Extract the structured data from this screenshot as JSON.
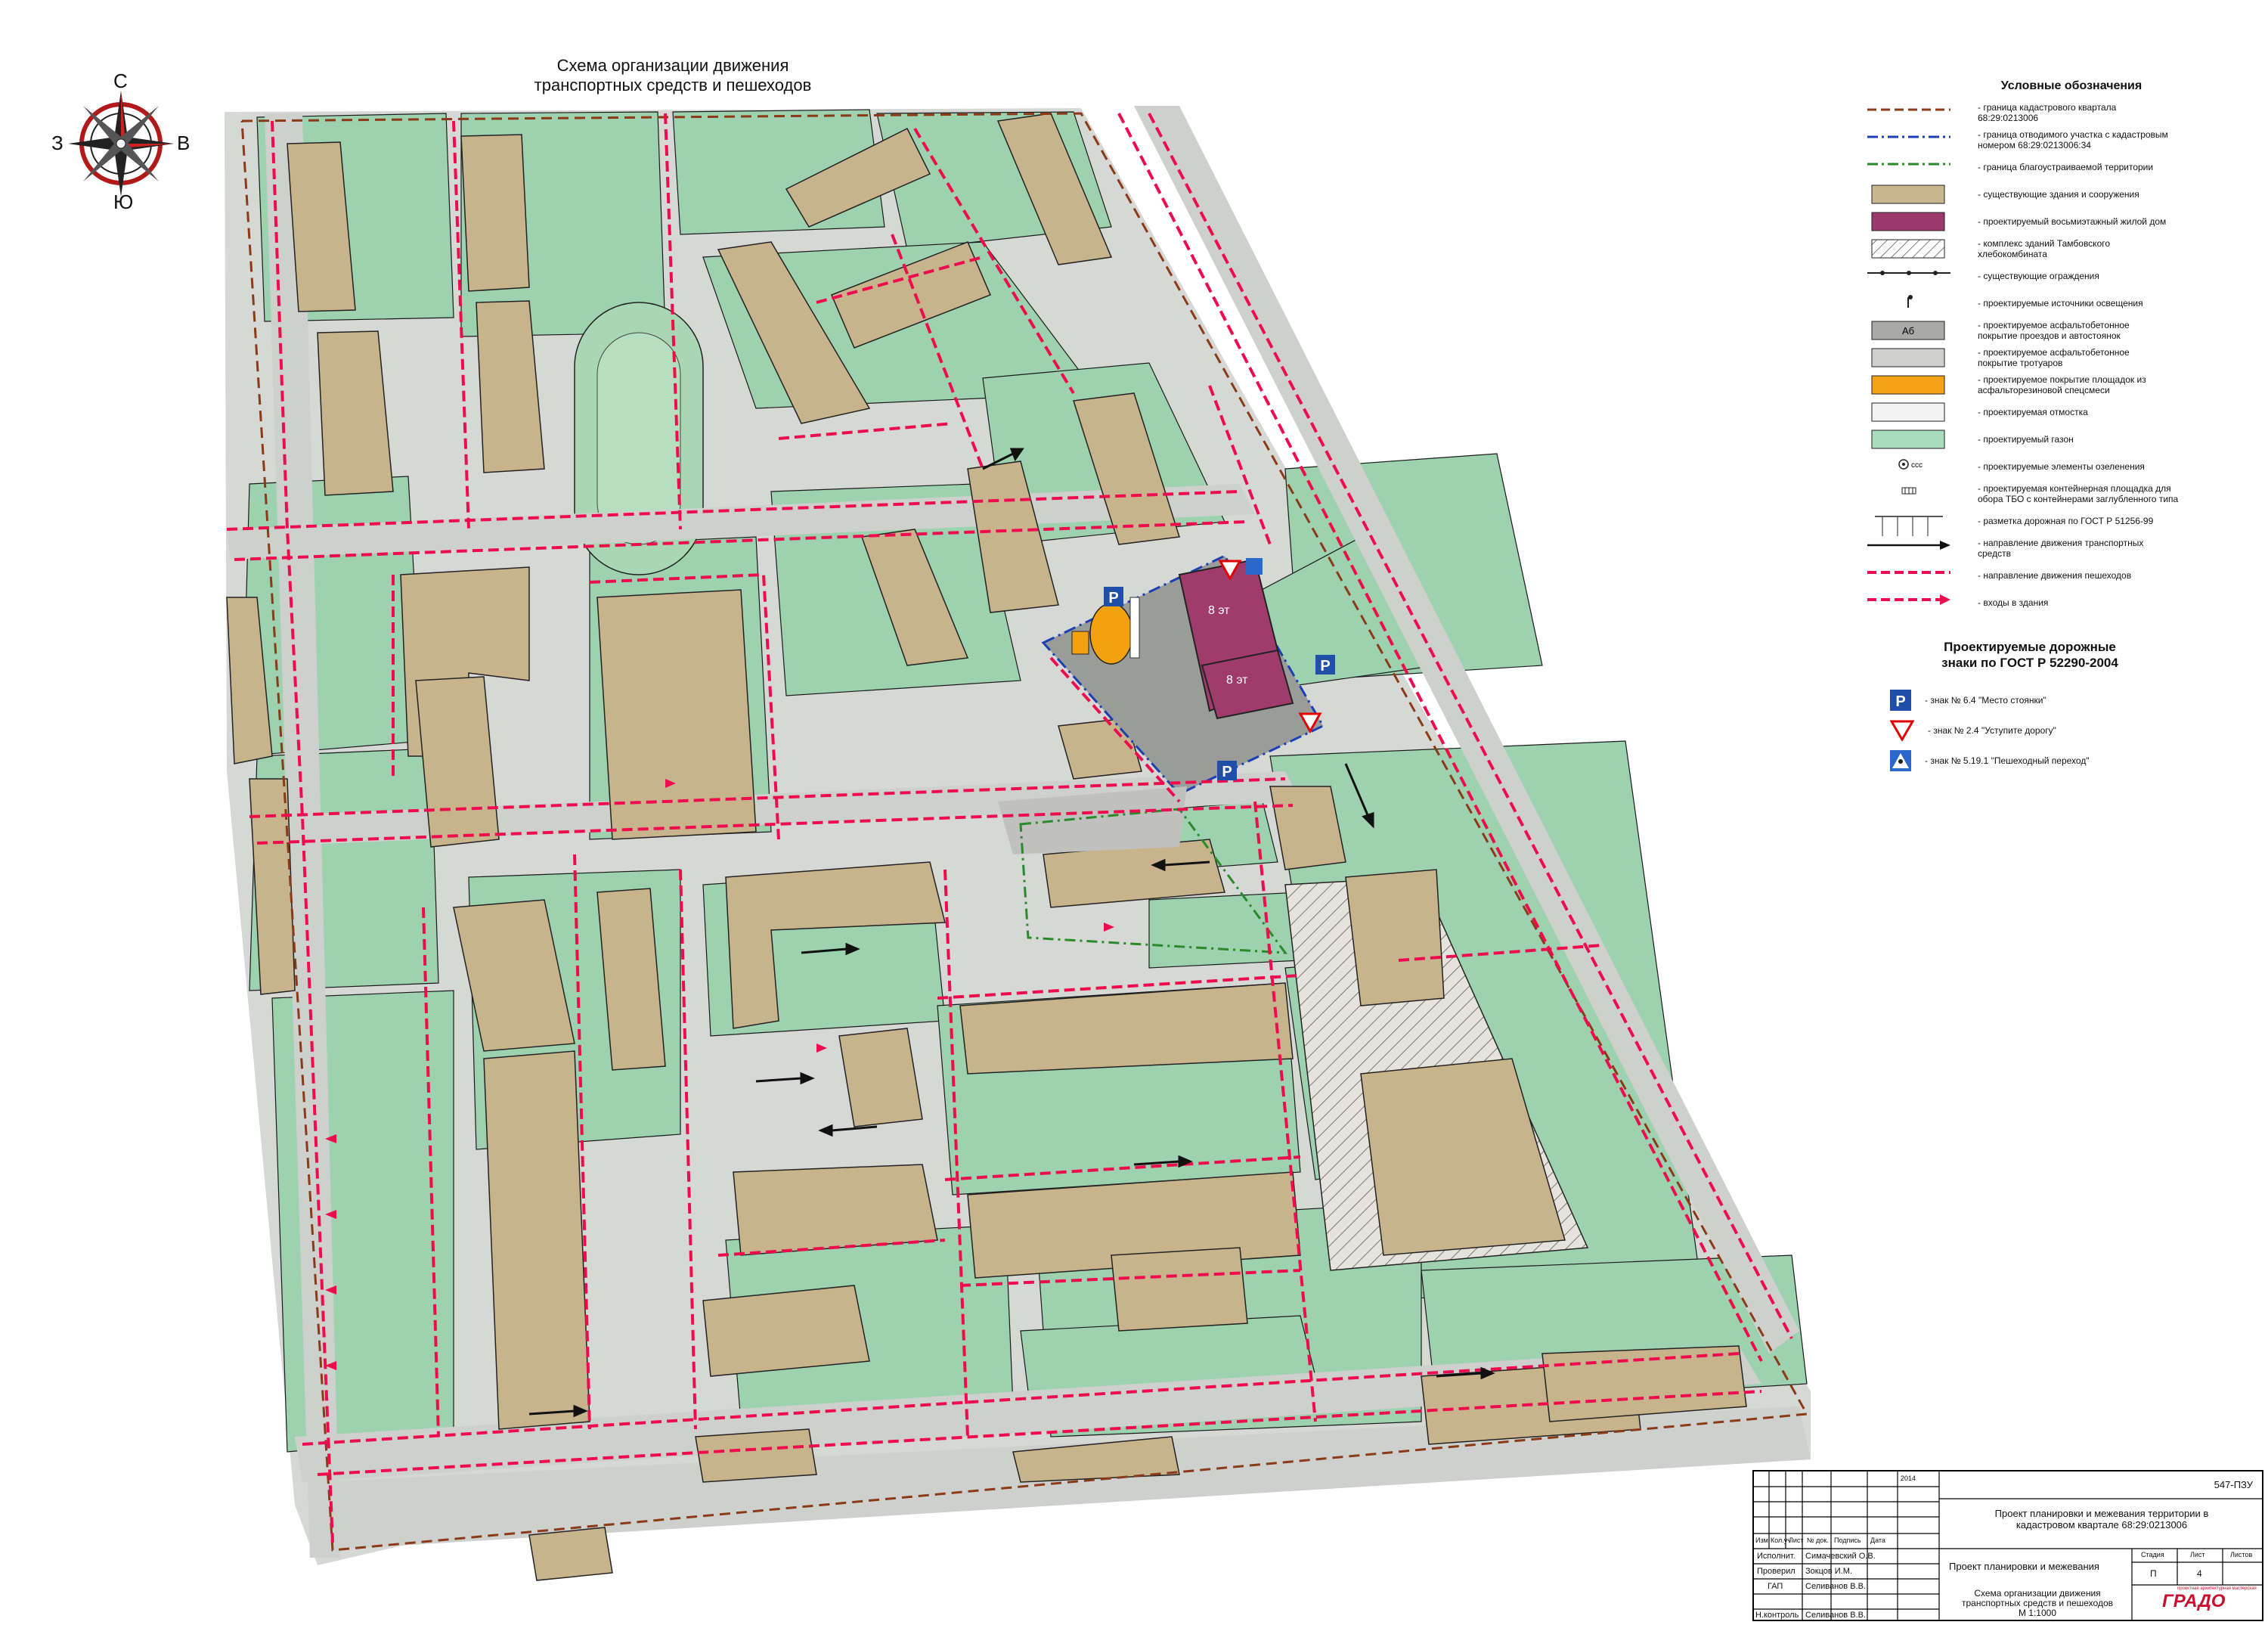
{
  "map_title": [
    "Схема организации движения",
    "транспортных средств и пешеходов"
  ],
  "compass": {
    "north": "С",
    "south": "Ю",
    "west": "З",
    "east": "В"
  },
  "legend": {
    "title": "Условные обозначения",
    "items": [
      {
        "symbol": "dash-brown",
        "text": [
          "- граница кадастрового квартала",
          "68:29:0213006"
        ]
      },
      {
        "symbol": "dashdot-blue",
        "text": [
          "- граница отводимого участка с кадастровым",
          "номером 68:29:0213006:34"
        ]
      },
      {
        "symbol": "dashdot-green",
        "text": [
          "- граница благоустраиваемой территории"
        ]
      },
      {
        "symbol": "box-tan",
        "text": [
          "- существующие здания и сооружения"
        ]
      },
      {
        "symbol": "box-purple",
        "text": [
          "- проектируемый восьмиэтажный жилой дом"
        ]
      },
      {
        "symbol": "box-hatched",
        "text": [
          "- комплекс зданий Тамбовского",
          "хлебокомбината"
        ]
      },
      {
        "symbol": "fence",
        "text": [
          "- существующие ограждения"
        ]
      },
      {
        "symbol": "lamp",
        "text": [
          "- проектируемые источники освещения"
        ]
      },
      {
        "symbol": "box-asphalt",
        "text": [
          "- проектируемое асфальтобетонное",
          "покрытие проездов и автостоянок"
        ]
      },
      {
        "symbol": "box-lightgray",
        "text": [
          "- проектируемое асфальтобетонное",
          "покрытие тротуаров"
        ]
      },
      {
        "symbol": "box-orange",
        "text": [
          "- проектируемое покрытие площадок из",
          "асфальторезиновой спецсмеси"
        ]
      },
      {
        "symbol": "box-white",
        "text": [
          "- проектируемая отмостка"
        ]
      },
      {
        "symbol": "box-green",
        "text": [
          "- проектируемый газон"
        ]
      },
      {
        "symbol": "trees",
        "text": [
          "- проектируемые элементы озеленения"
        ]
      },
      {
        "symbol": "bins",
        "text": [
          "- проектируемая контейнерная площадка для",
          "обора ТБО с контейнерами заглубленного типа"
        ]
      },
      {
        "symbol": "marking",
        "text": [
          "- разметка дорожная по ГОСТ Р 51256-99"
        ]
      },
      {
        "symbol": "arrow-black",
        "text": [
          "- направление движения транспортных",
          "средств"
        ]
      },
      {
        "symbol": "dash-red",
        "text": [
          "- направление движения пешеходов"
        ]
      },
      {
        "symbol": "arrow-red",
        "text": [
          "- входы в здания"
        ]
      }
    ],
    "asphalt_code": "Аб",
    "tree_code": "ссс"
  },
  "signs": {
    "title": [
      "Проектируемые дорожные",
      "знаки по ГОСТ Р 52290-2004"
    ],
    "items": [
      {
        "kind": "parking",
        "glyph": "P",
        "text": "- знак № 6.4 \"Место стоянки\""
      },
      {
        "kind": "yield",
        "glyph": "",
        "text": "- знак № 2.4 \"Уступите дорогу\""
      },
      {
        "kind": "crossing",
        "glyph": "",
        "text": "- знак № 5.19.1 \"Пешеходный переход\""
      }
    ]
  },
  "map_labels": {
    "floors_1": "8 эт",
    "floors_2": "8 эт",
    "parking_sign": "P",
    "parking_code": "Р"
  },
  "stamp": {
    "code": "547-ПЗУ",
    "year": "2014",
    "project": [
      "Проект планировки и межевания территории в",
      "кадастровом квартале 68:29:0213006"
    ],
    "stage_title": "Проект планировки и межевания",
    "sheet_title": [
      "Схема организации движения",
      "транспортных средств и пешеходов",
      "М 1:1000"
    ],
    "headers": [
      "Изм",
      "Кол.уч",
      "Лист",
      "№ док.",
      "Подпись",
      "Дата"
    ],
    "stage_headers": [
      "Стадия",
      "Лист",
      "Листов"
    ],
    "stage": "П",
    "sheet": "4",
    "roles": [
      {
        "role": "Исполнит.",
        "name": "Симачевский О.В."
      },
      {
        "role": "Проверил",
        "name": "Зокцов И.М."
      },
      {
        "role": "ГАП",
        "name": "Селиванов В.В."
      },
      {
        "role": "",
        "name": ""
      },
      {
        "role": "Н.контроль",
        "name": "Селиванов В.В."
      }
    ],
    "logo": "ГРАДО",
    "logo_caption": "проектная архитектурная мастерская"
  },
  "colors": {
    "lawn": "#9fd3b1",
    "building": "#c9b68e",
    "road": "#d4d6d3",
    "pedestrian": "#ee0c4f",
    "new_building": "#9c3a6b",
    "orange": "#f5a316"
  }
}
